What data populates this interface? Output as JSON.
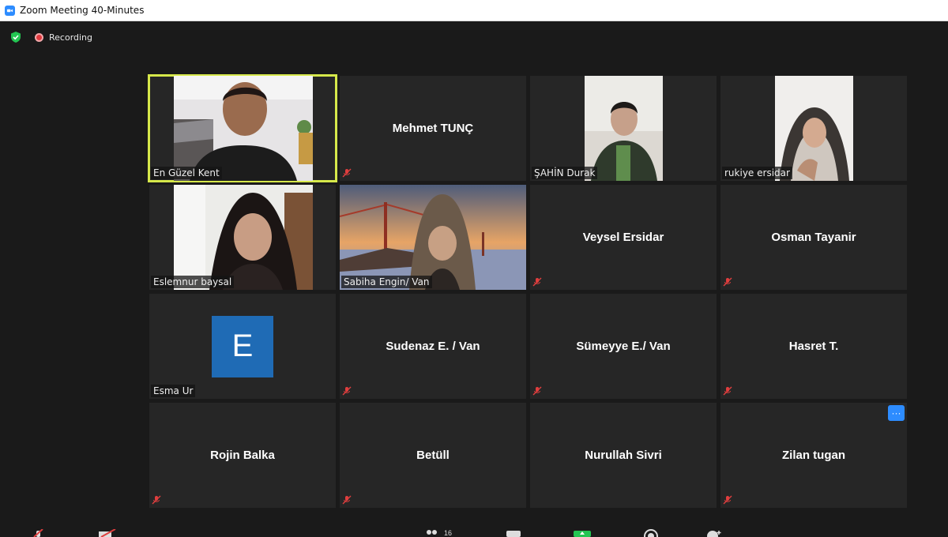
{
  "window": {
    "title": "Zoom Meeting 40-Minutes"
  },
  "status": {
    "recording_label": "Recording"
  },
  "participants": [
    {
      "name": "En Güzel Kent"
    },
    {
      "name": "Mehmet TUNÇ"
    },
    {
      "name": "ŞAHİN Durak"
    },
    {
      "name": "rukiye ersidar"
    },
    {
      "name": "Eslemnur baysal"
    },
    {
      "name": "Sabiha Engin/ Van"
    },
    {
      "name": "Veysel Ersidar"
    },
    {
      "name": "Osman Tayanir"
    },
    {
      "name": "Esma Ur",
      "avatar_letter": "E"
    },
    {
      "name": "Sudenaz E. / Van"
    },
    {
      "name": "Sümeyye E./ Van"
    },
    {
      "name": "Hasret T."
    },
    {
      "name": "Rojin Balka"
    },
    {
      "name": "Betüll"
    },
    {
      "name": "Nurullah Sivri"
    },
    {
      "name": "Zilan tugan",
      "more_label": "···"
    }
  ],
  "toolbar": {
    "participants_count": "16"
  },
  "colors": {
    "active_speaker": "#d6e84a",
    "accent": "#2d8cff",
    "tile": "#262626",
    "background": "#1a1a1a"
  }
}
